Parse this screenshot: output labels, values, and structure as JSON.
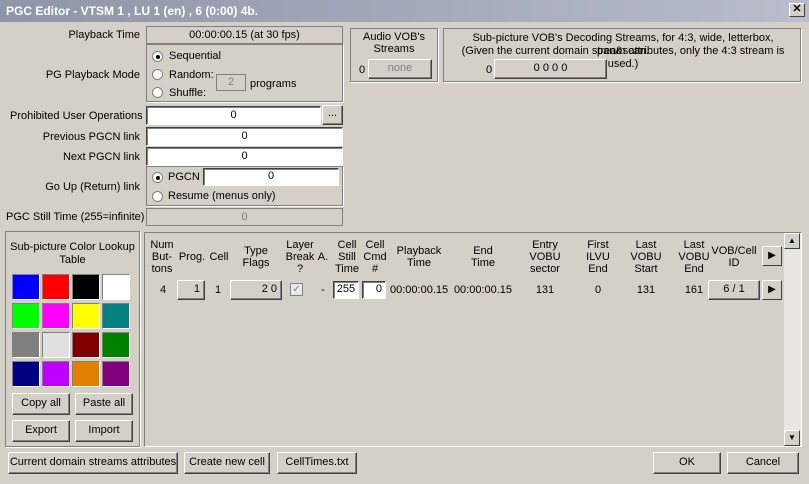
{
  "window": {
    "title": "PGC Editor - VTSM 1 , LU 1 (en) , 6  (0:00)  4b.",
    "close": "✕"
  },
  "playback_time": {
    "label": "Playback Time",
    "value": "00:00:00.15 (at 30 fps)"
  },
  "pg_mode": {
    "label": "PG Playback Mode",
    "sequential": "Sequential",
    "random": "Random:",
    "shuffle": "Shuffle:",
    "programs_value": "2",
    "programs_label": "programs",
    "selected": "sequential"
  },
  "audio": {
    "title": "Audio VOB's Streams",
    "count": "0",
    "value": "none"
  },
  "subpic": {
    "title": "Sub-picture VOB's Decoding Streams, for 4:3, wide, letterbox, pan&scan.",
    "note": "(Given the current domain stream attributes, only the 4:3 stream is used.)",
    "count": "0",
    "value": "0   0  0  0"
  },
  "prohibited": {
    "label": "Prohibited User Operations",
    "value": "0",
    "btn": "..."
  },
  "prev_pgcn": {
    "label": "Previous PGCN link",
    "value": "0"
  },
  "next_pgcn": {
    "label": "Next PGCN link",
    "value": "0"
  },
  "go_up": {
    "label": "Go Up (Return) link",
    "pgcn_label": "PGCN",
    "pgcn_value": "0",
    "resume_label": "Resume (menus only)"
  },
  "still": {
    "label": "PGC Still Time (255=infinite)",
    "value": "0"
  },
  "clut": {
    "title": "Sub-picture Color Lookup Table",
    "colors": [
      "#0000ff",
      "#ff0000",
      "#000000",
      "#ffffff",
      "#00ff00",
      "#ff00ff",
      "#ffff00",
      "#008080",
      "#808080",
      "#e0e0e0",
      "#800000",
      "#008000",
      "#000080",
      "#c000ff",
      "#e08000",
      "#800080"
    ],
    "copy_all": "Copy all",
    "paste_all": "Paste all",
    "export": "Export",
    "import": "Import"
  },
  "cells": {
    "headers": {
      "num_buttons": "Num\nBut-\ntons",
      "prog": "Prog.",
      "cell": "Cell",
      "type_flags": "Type\nFlags",
      "layer_break": "Layer\nBreak\n?",
      "a": "A.",
      "still": "Cell\nStill\nTime",
      "cmd": "Cell\nCmd\n#",
      "playback": "Playback\nTime",
      "end": "End\nTime",
      "entry_vobu": "Entry\nVOBU\nsector",
      "first_ilvu": "First\nILVU\nEnd",
      "last_vobu_start": "Last\nVOBU\nStart",
      "last_vobu_end": "Last\nVOBU\nEnd",
      "vob_cell": "VOB/Cell\nID"
    },
    "row": {
      "num_buttons": "4",
      "prog": "1",
      "cell": "1",
      "type_flags": "2   0",
      "a": "-",
      "still": "255",
      "cmd": "0",
      "playback": "00:00:00.15",
      "end": "00:00:00.15",
      "entry_vobu": "131",
      "first_ilvu": "0",
      "last_vobu_start": "131",
      "last_vobu_end": "161",
      "vob_cell": "6 / 1",
      "checkmark": "✓"
    }
  },
  "footer": {
    "streams_btn": "Current domain streams attributes",
    "create_cell": "Create new cell",
    "celltimes": "CellTimes.txt",
    "ok": "OK",
    "cancel": "Cancel"
  }
}
